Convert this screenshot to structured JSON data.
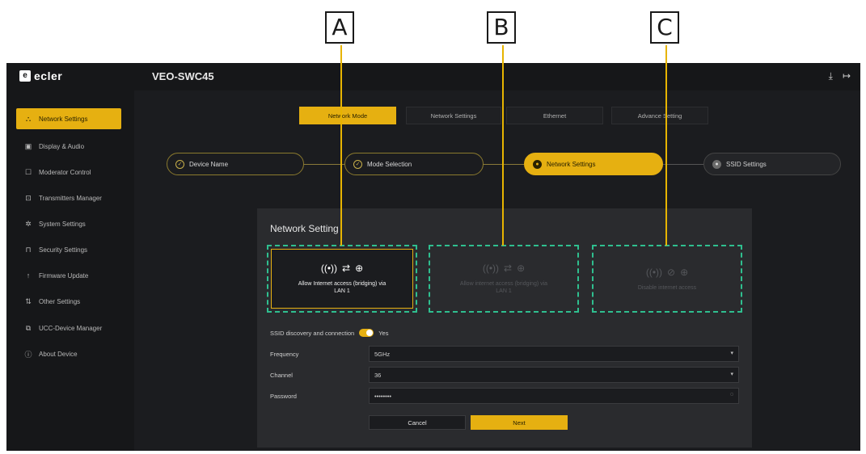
{
  "callouts": [
    "A",
    "B",
    "C"
  ],
  "app": {
    "logo_mark": "e",
    "logo_text": "ecler",
    "device_title": "VEO-SWC45",
    "top_icons": [
      "download-icon",
      "logout-icon"
    ]
  },
  "sidebar": {
    "items": [
      {
        "label": "Network Settings",
        "icon": "network-icon",
        "active": true
      },
      {
        "label": "Display & Audio",
        "icon": "display-icon"
      },
      {
        "label": "Moderator Control",
        "icon": "moderator-icon"
      },
      {
        "label": "Transmitters Manager",
        "icon": "transmitter-icon"
      },
      {
        "label": "System Settings",
        "icon": "gear-icon"
      },
      {
        "label": "Security Settings",
        "icon": "lock-icon"
      },
      {
        "label": "Firmware Update",
        "icon": "upload-icon"
      },
      {
        "label": "Other Settings",
        "icon": "sliders-icon"
      },
      {
        "label": "UCC-Device Manager",
        "icon": "devices-icon"
      },
      {
        "label": "About Device",
        "icon": "info-icon"
      }
    ]
  },
  "tabs": [
    "Network Mode",
    "Network Settings",
    "Ethernet",
    "Advance Setting"
  ],
  "steps": [
    {
      "label": "Device Name",
      "state": "done"
    },
    {
      "label": "Mode Selection",
      "state": "done"
    },
    {
      "label": "Network Settings",
      "state": "active"
    },
    {
      "label": "SSID Settings",
      "state": "pending"
    }
  ],
  "panel": {
    "title": "Network Setting",
    "options": [
      {
        "text": "Allow Internet access (bridging) via LAN 1",
        "icons": "wifi-swap-globe",
        "selected": true
      },
      {
        "text": "Allow internet access (bridging) via LAN 1",
        "icons": "wifi-swap-globe",
        "selected": false
      },
      {
        "text": "Disable internet access",
        "icons": "wifi-block-globe",
        "selected": false
      }
    ],
    "ssid_toggle_label": "SSID discovery and connection",
    "ssid_toggle_value": "Yes",
    "fields": [
      {
        "label": "Frequency",
        "value": "5GHz"
      },
      {
        "label": "Channel",
        "value": "36"
      },
      {
        "label": "Password",
        "value": "••••••••"
      }
    ],
    "cancel_label": "Cancel",
    "next_label": "Next"
  }
}
